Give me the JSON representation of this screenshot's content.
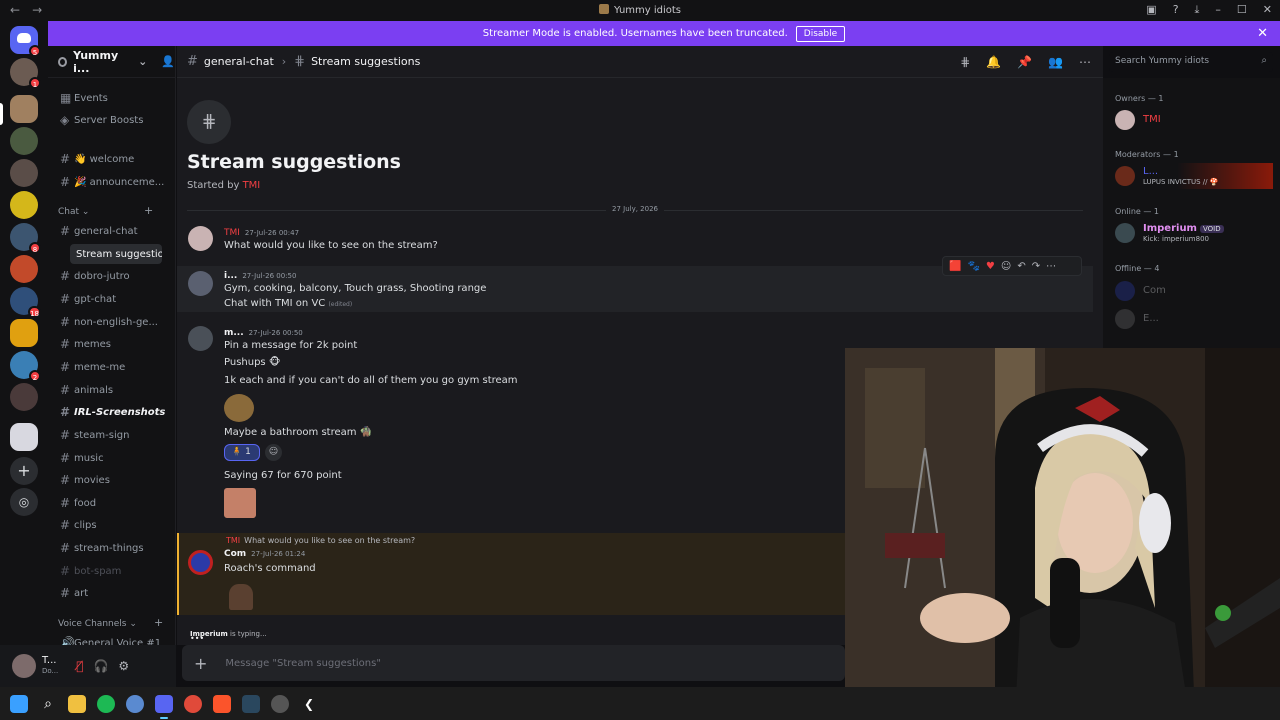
{
  "titlebar": {
    "title": "Yummy idiots",
    "back": "←",
    "forward": "→"
  },
  "banner": {
    "text": "Streamer Mode is enabled. Usernames have been truncated.",
    "button": "Disable"
  },
  "server": {
    "name": "Yummy i..."
  },
  "sidebar": {
    "top_items": [
      {
        "label": "Events"
      },
      {
        "label": "Server Boosts"
      }
    ],
    "channels_pre": [
      {
        "label": "👋 welcome"
      },
      {
        "label": "🎉 announceme..."
      }
    ],
    "category_chat": "Chat",
    "channels": [
      {
        "label": "general-chat"
      },
      {
        "label": "Stream suggestions"
      },
      {
        "label": "dobro-jutro"
      },
      {
        "label": "gpt-chat"
      },
      {
        "label": "non-english-ge..."
      },
      {
        "label": "memes"
      },
      {
        "label": "meme-me"
      },
      {
        "label": "animals"
      },
      {
        "label": "IRL-Screenshots"
      },
      {
        "label": "steam-sign"
      },
      {
        "label": "music"
      },
      {
        "label": "movies"
      },
      {
        "label": "food"
      },
      {
        "label": "clips"
      },
      {
        "label": "stream-things"
      },
      {
        "label": "bot-spam"
      },
      {
        "label": "art"
      }
    ],
    "category_voice": "Voice Channels",
    "voice_partial": "General Voice #1"
  },
  "userpanel": {
    "name": "T...",
    "status": "Do..."
  },
  "header": {
    "channel": "general-chat",
    "thread": "Stream suggestions"
  },
  "search": {
    "placeholder": "Search Yummy idiots"
  },
  "thread": {
    "title": "Stream suggestions",
    "started_prefix": "Started by",
    "started_by": "TMI"
  },
  "date_divider": "27 July, 2026",
  "messages": [
    {
      "author": "TMI",
      "time": "27-Jul-26 00:47",
      "lines": [
        "What would you like to see on the stream?"
      ]
    },
    {
      "author": "i...",
      "time": "27-Jul-26 00:50",
      "lines": [
        "Gym, cooking, balcony, Touch grass, Shooting range",
        "Chat with TMI on VC"
      ],
      "edited": "(edited)"
    },
    {
      "author": "m...",
      "time": "27-Jul-26 00:50",
      "lines": [
        "Pin a message for 2k point",
        "Pushups 🐵",
        "1k each and if you can't do all of them you go gym stream",
        "Maybe a bathroom stream 🧌",
        "Saying 67 for 670 point"
      ],
      "reaction_count": "1"
    },
    {
      "author": "Com",
      "time": "27-Jul-26 01:24",
      "reply_to_author": "TMI",
      "reply_to_text": "What would you like to see on the stream?",
      "lines": [
        "Roach's command"
      ]
    }
  ],
  "typing": {
    "user": "Imperium",
    "text": " is typing..."
  },
  "composer": {
    "placeholder": "Message \"Stream suggestions\""
  },
  "members": {
    "owners_header": "Owners — 1",
    "owner": {
      "name": "TMI"
    },
    "moderators_header": "Moderators — 1",
    "moderator": {
      "name": "L...",
      "status": "LUPUS INVICTUS // 🍄"
    },
    "online_header": "Online — 1",
    "online": {
      "name": "Imperium",
      "tag": "VOID",
      "status": "Kick: imperium800"
    },
    "offline_header": "Offline — 4",
    "offline": [
      {
        "name": "Com"
      },
      {
        "name": "E..."
      }
    ]
  },
  "colors": {
    "brand": "#7b3ff2",
    "danger": "#f23f43",
    "accent": "#5865f2"
  }
}
